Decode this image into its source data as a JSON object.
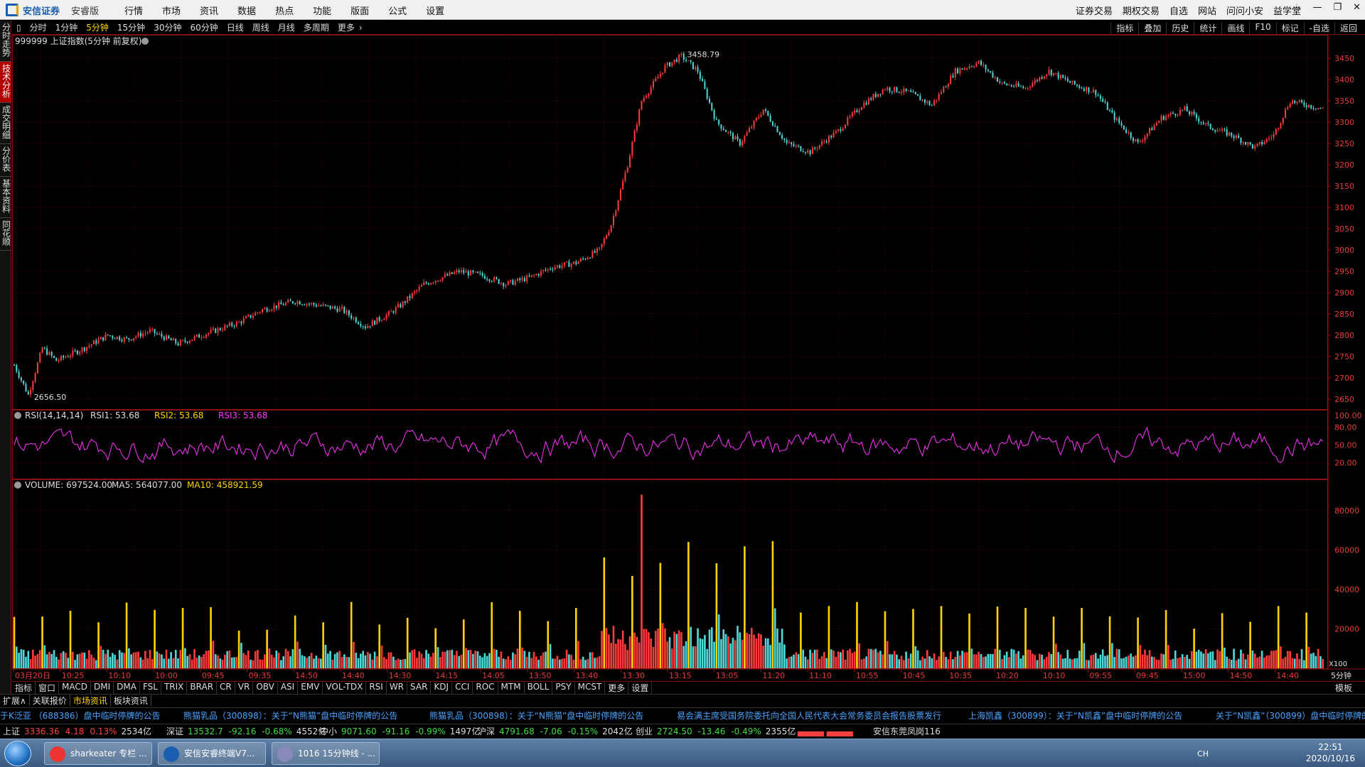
{
  "app": {
    "logo_text": "安信证券",
    "edition": "安睿版"
  },
  "menu": [
    "行情",
    "市场",
    "资讯",
    "数据",
    "热点",
    "功能",
    "版面",
    "公式",
    "设置"
  ],
  "right_links": [
    "证券交易",
    "期权交易",
    "自选",
    "网站",
    "问问小安",
    "益学堂"
  ],
  "window_controls": [
    "skin-icon",
    "minimize-icon",
    "restore-icon",
    "close-icon"
  ],
  "left_tabs": [
    "分时走势",
    "技术分析",
    "成交明细",
    "分价表",
    "基本资料",
    "同花顺"
  ],
  "left_tab_active": 1,
  "periods": [
    "分时",
    "1分钟",
    "5分钟",
    "15分钟",
    "30分钟",
    "60分钟",
    "日线",
    "周线",
    "月线",
    "多周期",
    "更多"
  ],
  "period_active": 2,
  "right_tools": [
    "指标",
    "叠加",
    "历史",
    "统计",
    "画线",
    "F10",
    "标记",
    "-自选",
    "返回"
  ],
  "panels": {
    "price": {
      "title": "999999 上证指数(5分钟 前复权)",
      "high_label": "3458.79",
      "low_label": "2656.50",
      "axis_ticks": [
        "3450",
        "3400",
        "3350",
        "3300",
        "3250",
        "3200",
        "3150",
        "3100",
        "3050",
        "3000",
        "2950",
        "2900",
        "2850",
        "2800",
        "2750",
        "2700",
        "2650"
      ]
    },
    "rsi": {
      "title": "RSI(14,14,14)",
      "rsi1": "RSI1: 53.68",
      "rsi2": "RSI2: 53.68",
      "rsi3": "RSI3: 53.68",
      "axis_ticks": [
        "100.00",
        "80.00",
        "50.00",
        "20.00"
      ]
    },
    "volume": {
      "title": "VOLUME: 697524.00",
      "ma5": "MA5: 564077.00",
      "ma10": "MA10: 458921.59",
      "axis_ticks": [
        "80000",
        "60000",
        "40000",
        "20000"
      ],
      "unit": "X100"
    }
  },
  "time_axis": [
    "03月20日",
    "10:25",
    "10:10",
    "10:00",
    "09:45",
    "09:35",
    "14:50",
    "14:40",
    "14:30",
    "14:15",
    "14:05",
    "13:50",
    "13:40",
    "13:30",
    "13:15",
    "13:05",
    "11:20",
    "11:10",
    "10:55",
    "10:45",
    "10:35",
    "10:20",
    "10:10",
    "09:55",
    "09:45",
    "15:00",
    "14:50",
    "14:40"
  ],
  "time_axis_right": "5分钟",
  "indicators": [
    "指标",
    "窗口",
    "MACD",
    "DMI",
    "DMA",
    "FSL",
    "TRIX",
    "BRAR",
    "CR",
    "VR",
    "OBV",
    "ASI",
    "EMV",
    "VOL-TDX",
    "RSI",
    "WR",
    "SAR",
    "KDJ",
    "CCI",
    "ROC",
    "MTM",
    "BOLL",
    "PSY",
    "MCST",
    "更多",
    "设置"
  ],
  "indicator_right": "模板",
  "bottom_tabs": [
    "扩展∧",
    "关联报价",
    "市场资讯",
    "板块资讯"
  ],
  "bottom_tab_active": 2,
  "news": [
    "于K泛亚 （688386）盘中临时停牌的公告",
    "熊猫乳品（300898）：关于“N熊猫”盘中临时停牌的公告",
    "熊猫乳品（300898）：关于“N熊猫”盘中临时停牌的公告",
    "易会满主席受国务院委托向全国人民代表大会常务委员会报告股票发行",
    "上海凯鑫（300899）：关于“N凯鑫”盘中临时停牌的公告",
    "关于“N凯鑫”（300899）盘中临时停牌的公"
  ],
  "indexes": [
    {
      "name": "上证",
      "value": "3336.36",
      "change": "4.18",
      "pct": "0.13%",
      "amount": "2534亿",
      "dir": "up"
    },
    {
      "name": "深证",
      "value": "13532.7",
      "change": "-92.16",
      "pct": "-0.68%",
      "amount": "4552亿",
      "dir": "dn"
    },
    {
      "name": "中小",
      "value": "9071.60",
      "change": "-91.16",
      "pct": "-0.99%",
      "amount": "1497亿",
      "dir": "dn"
    },
    {
      "name": "沪深",
      "value": "4791.68",
      "change": "-7.06",
      "pct": "-0.15%",
      "amount": "2042亿",
      "dir": "dn"
    },
    {
      "name": "创业",
      "value": "2724.50",
      "change": "-13.46",
      "pct": "-0.49%",
      "amount": "2355亿",
      "dir": "dn"
    }
  ],
  "broker_branch": "安信东莞凤岗116",
  "taskbar": {
    "tasks": [
      "sharkeater 专栏 ...",
      "安信安睿终端V7...",
      "1016 15分钟线 - ..."
    ],
    "lang": "CH"
  },
  "clock": {
    "time": "22:51",
    "date": "2020/10/16"
  },
  "colors": {
    "up": "#ff3b3b",
    "down": "#4fd8d8",
    "rsi": "#ff33ff",
    "grid": "#5a0000",
    "frame": "#8b1010",
    "ma_yellow": "#ffd200"
  },
  "chart_data": {
    "type": "candlestick",
    "price_range": [
      2640,
      3475
    ],
    "high": 3458.79,
    "low": 2656.5,
    "trend_keyframes": [
      [
        0,
        2730
      ],
      [
        6,
        2660
      ],
      [
        12,
        2770
      ],
      [
        18,
        2740
      ],
      [
        30,
        2770
      ],
      [
        40,
        2800
      ],
      [
        48,
        2790
      ],
      [
        58,
        2810
      ],
      [
        70,
        2780
      ],
      [
        80,
        2800
      ],
      [
        96,
        2830
      ],
      [
        106,
        2860
      ],
      [
        120,
        2880
      ],
      [
        130,
        2870
      ],
      [
        140,
        2860
      ],
      [
        150,
        2820
      ],
      [
        160,
        2850
      ],
      [
        165,
        2870
      ],
      [
        175,
        2920
      ],
      [
        190,
        2950
      ],
      [
        200,
        2940
      ],
      [
        210,
        2920
      ],
      [
        220,
        2935
      ],
      [
        230,
        2960
      ],
      [
        240,
        2970
      ],
      [
        250,
        3000
      ],
      [
        255,
        3060
      ],
      [
        262,
        3200
      ],
      [
        268,
        3350
      ],
      [
        278,
        3430
      ],
      [
        285,
        3455
      ],
      [
        292,
        3420
      ],
      [
        300,
        3300
      ],
      [
        310,
        3250
      ],
      [
        320,
        3330
      ],
      [
        330,
        3250
      ],
      [
        340,
        3230
      ],
      [
        352,
        3280
      ],
      [
        362,
        3340
      ],
      [
        372,
        3380
      ],
      [
        382,
        3370
      ],
      [
        392,
        3340
      ],
      [
        402,
        3420
      ],
      [
        412,
        3440
      ],
      [
        422,
        3390
      ],
      [
        432,
        3380
      ],
      [
        442,
        3420
      ],
      [
        452,
        3390
      ],
      [
        462,
        3370
      ],
      [
        470,
        3310
      ],
      [
        480,
        3250
      ],
      [
        490,
        3310
      ],
      [
        500,
        3330
      ],
      [
        510,
        3290
      ],
      [
        520,
        3270
      ],
      [
        530,
        3240
      ],
      [
        538,
        3270
      ],
      [
        545,
        3350
      ],
      [
        560,
        3330
      ]
    ],
    "candle_count": 560,
    "rsi": {
      "range": [
        0,
        100
      ],
      "ticks": [
        20,
        50,
        80,
        100
      ],
      "last": 53.68
    },
    "volume": {
      "range": [
        0,
        90000
      ],
      "ticks": [
        20000,
        40000,
        60000,
        80000
      ],
      "last": 697524.0,
      "ma5": 564077.0,
      "ma10": 458921.59
    }
  }
}
